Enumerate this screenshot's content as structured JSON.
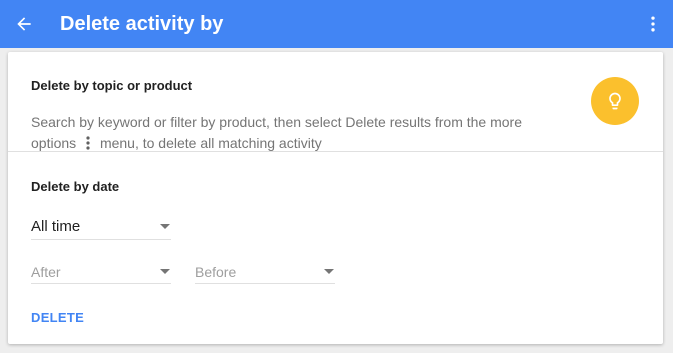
{
  "appbar": {
    "title": "Delete activity by",
    "back_icon": "arrow-back-icon",
    "menu_icon": "more-vert-icon",
    "background": "#4285f4"
  },
  "topic_section": {
    "title": "Delete by topic or product",
    "description_before": "Search by keyword or filter by product, then select Delete results from the more options",
    "description_after": "menu, to delete all matching activity",
    "inline_icon": "more-vert-icon",
    "tip_icon": "lightbulb-icon",
    "tip_color": "#fbc02d"
  },
  "date_section": {
    "title": "Delete by date",
    "range_select": {
      "value": "All time"
    },
    "after_select": {
      "placeholder": "After"
    },
    "before_select": {
      "placeholder": "Before"
    },
    "delete_label": "DELETE",
    "accent": "#4285f4"
  }
}
